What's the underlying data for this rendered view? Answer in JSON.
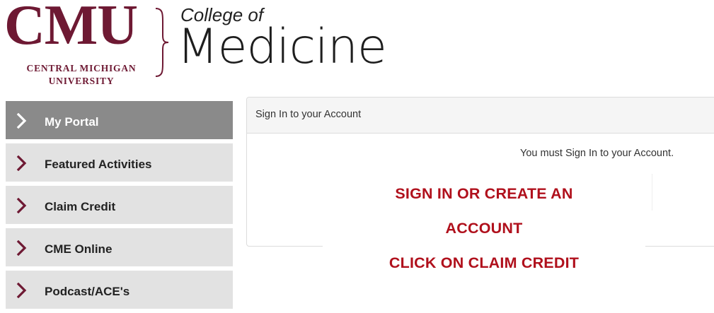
{
  "logo": {
    "wordmark": "CMU",
    "sub_line1": "CENTRAL MICHIGAN",
    "sub_line2": "UNIVERSITY",
    "college": "College of",
    "medicine": "Medicine",
    "colors": {
      "maroon": "#6e1933",
      "dark": "#1e1e1e"
    }
  },
  "sidebar": {
    "items": [
      {
        "label": "My Portal",
        "active": true,
        "icon": "chevron-right-icon"
      },
      {
        "label": "Featured Activities",
        "active": false,
        "icon": "chevron-right-icon"
      },
      {
        "label": "Claim Credit",
        "active": false,
        "icon": "chevron-right-icon"
      },
      {
        "label": "CME Online",
        "active": false,
        "icon": "chevron-right-icon"
      },
      {
        "label": "Podcast/ACE's",
        "active": false,
        "icon": "chevron-right-icon"
      }
    ],
    "colors": {
      "active_bg": "#8a8a8a",
      "item_bg": "#e2e2e2",
      "chevron": "#6e1933"
    }
  },
  "panel": {
    "title": "Sign In to your Account",
    "message": "You must Sign In to your Account."
  },
  "callout": {
    "line1": "SIGN IN OR CREATE AN",
    "line2": "ACCOUNT",
    "line3": "CLICK ON CLAIM CREDIT",
    "color": "#b0101c"
  }
}
